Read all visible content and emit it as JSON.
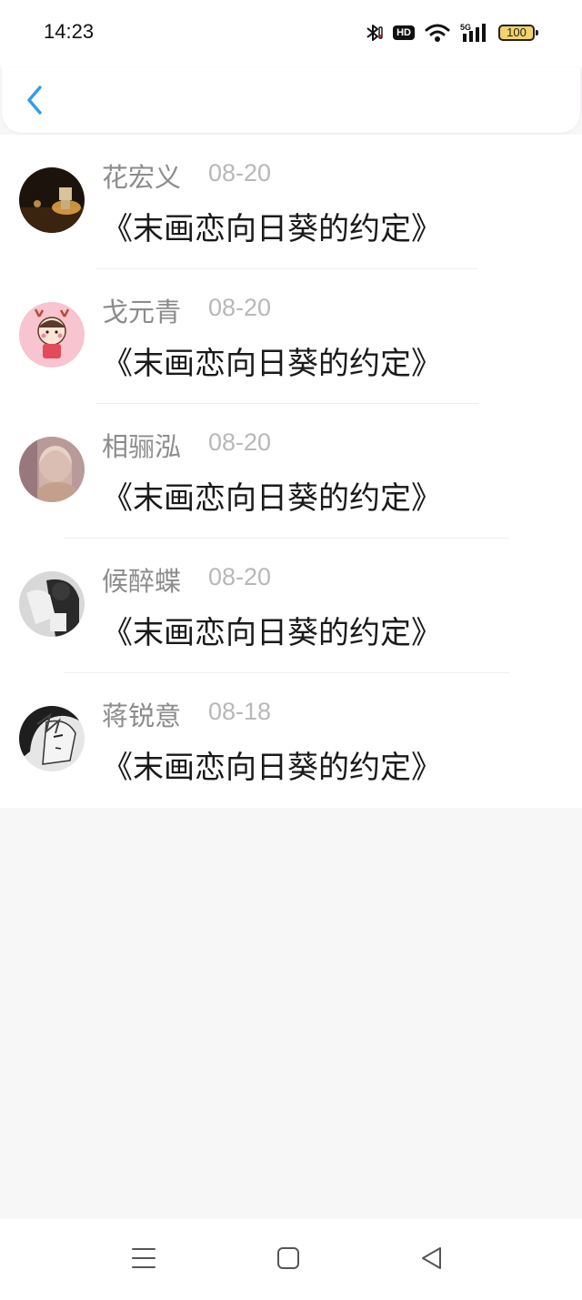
{
  "status": {
    "time": "14:23",
    "hd": "HD",
    "network": "5G",
    "battery": "100"
  },
  "header": {
    "back_icon": "chevron-left-icon"
  },
  "items": [
    {
      "name": "花宏义",
      "date": "08-20",
      "title": "《末画恋向日葵的约定》"
    },
    {
      "name": "戈元青",
      "date": "08-20",
      "title": "《末画恋向日葵的约定》"
    },
    {
      "name": "相骊泓",
      "date": "08-20",
      "title": "《末画恋向日葵的约定》"
    },
    {
      "name": "候醉蝶",
      "date": "08-20",
      "title": "《末画恋向日葵的约定》"
    },
    {
      "name": "蒋锐意",
      "date": "08-18",
      "title": "《末画恋向日葵的约定》"
    }
  ],
  "bottom_nav": [
    "menu-icon",
    "home-square-icon",
    "back-triangle-icon"
  ],
  "colors": {
    "accent": "#2f9cf0",
    "name_text": "#8c8c8c",
    "date_text": "#b8b8b8",
    "background": "#f8f7f8"
  }
}
